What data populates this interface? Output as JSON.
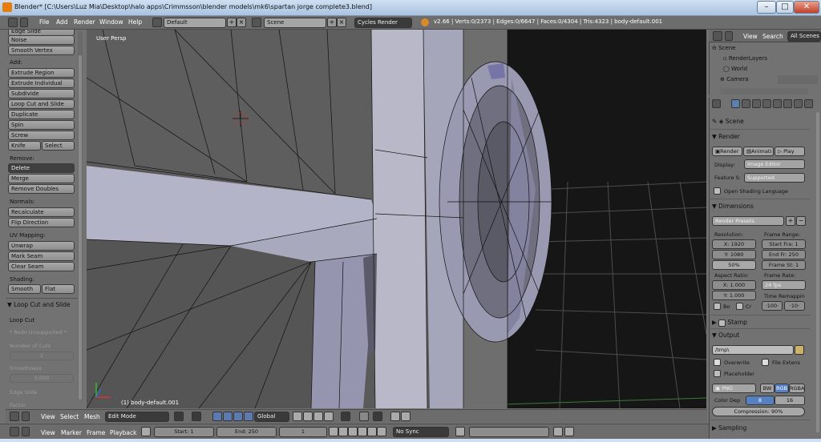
{
  "window": {
    "title": "Blender* [C:\\Users\\Luz Mia\\Desktop\\halo apps\\Crimmsson\\blender models\\mk6\\spartan jorge complete3.blend]"
  },
  "menubar": {
    "items": [
      "File",
      "Add",
      "Render",
      "Window",
      "Help"
    ],
    "layout_value": "Default",
    "scene_value": "Scene",
    "engine_value": "Cycles Render",
    "info": "v2.66 | Verts:0/2373 | Edges:0/6647 | Faces:0/4304 | Tris:4323 | body-default.001"
  },
  "toolshelf": {
    "top_partial": "Edge Slide",
    "top_buttons": [
      "Noise",
      "Smooth Vertex"
    ],
    "add_label": "Add:",
    "add_buttons": [
      "Extrude Region",
      "Extrude Individual",
      "Subdivide",
      "Loop Cut and Slide",
      "Duplicate",
      "Spin",
      "Screw"
    ],
    "knife": "Knife",
    "select": "Select",
    "remove_label": "Remove:",
    "delete": "Delete",
    "merge": "Merge",
    "remove_doubles": "Remove Doubles",
    "normals_label": "Normals:",
    "recalculate": "Recalculate",
    "flip_direction": "Flip Direction",
    "uv_label": "UV Mapping:",
    "unwrap": "Unwrap",
    "mark_seam": "Mark Seam",
    "clear_seam": "Clear Seam",
    "shading_label": "Shading:",
    "smooth": "Smooth",
    "flat": "Flat",
    "op_title": "Loop Cut and Slide",
    "op_name": "Loop Cut",
    "op_redo": "* Redo Unsupported *",
    "num_cuts_label": "Number of Cuts",
    "num_cuts_value": "1",
    "smoothness_label": "Smoothness",
    "smoothness_value": "0.000",
    "edge_slide_label": "Edge Slide",
    "factor_label": "Factor"
  },
  "viewport": {
    "label": "User Persp",
    "object": "(1) body-default.001"
  },
  "viewport_header": {
    "items": [
      "View",
      "Select",
      "Mesh"
    ],
    "mode": "Edit Mode",
    "orientation": "Global"
  },
  "timeline": {
    "items": [
      "View",
      "Marker",
      "Frame",
      "Playback"
    ],
    "start": "Start: 1",
    "end": "End: 250",
    "current": "1",
    "sync": "No Sync"
  },
  "outliner": {
    "tabs": [
      "View",
      "Search",
      "All Scenes"
    ],
    "rows": [
      "Scene",
      "RenderLayers",
      "World",
      "Camera"
    ]
  },
  "properties": {
    "scene": "Scene",
    "render_header": "Render",
    "render_btn": "Render",
    "anim_btn": "Animati",
    "play_btn": "Play",
    "display_label": "Display:",
    "display_value": "Image Editor",
    "feature_label": "Feature S:",
    "feature_value": "Supported",
    "osl_label": "Open Shading Language",
    "dimensions_header": "Dimensions",
    "presets": "Render Presets",
    "resolution_label": "Resolution:",
    "res_x": "X: 1920",
    "res_y": "Y: 1080",
    "res_pct": "50%",
    "frame_range_label": "Frame Range:",
    "start_frame": "Start Fra: 1",
    "end_frame": "End Fr: 250",
    "frame_step": "Frame St: 1",
    "aspect_label": "Aspect Ratio:",
    "asp_x": "X: 1.000",
    "asp_y": "Y: 1.000",
    "frame_rate_label": "Frame Rate:",
    "fps": "24 fps",
    "time_remap_label": "Time Remappin",
    "bo_label": "Bo",
    "cr_label": "Cr",
    "remap_old": "·100·",
    "remap_new": "·10·",
    "stamp_header": "Stamp",
    "output_header": "Output",
    "output_path": "/tmp\\",
    "overwrite": "Overwrite",
    "file_ext": "File Extens",
    "placeholder": "Placeholder",
    "format": "PNG",
    "bw": "BW",
    "rgb": "RGB",
    "rgba": "RGBA",
    "color_depth_label": "Color Dep",
    "depth_8": "8",
    "depth_16": "16",
    "compression": "Compression: 90%",
    "sampling_header": "Sampling"
  }
}
